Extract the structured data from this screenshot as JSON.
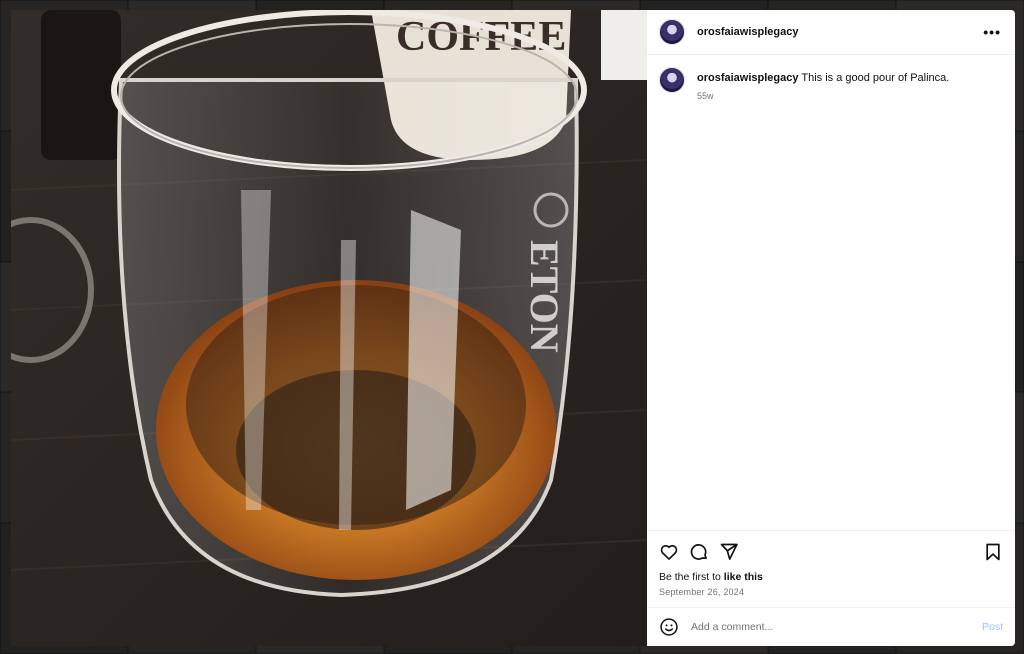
{
  "post": {
    "username": "orosfaiawisplegacy",
    "more_icon": "more-horizontal-icon",
    "caption": {
      "username": "orosfaiawisplegacy",
      "text": "This is a good pour of Palinca.",
      "time_ago": "55w"
    },
    "likes": {
      "prefix": "Be the first to ",
      "link": "like this"
    },
    "date": "September 26, 2024",
    "comment": {
      "placeholder": "Add a comment...",
      "post_label": "Post"
    },
    "glass_text": [
      "COFFEE",
      "ETON"
    ]
  },
  "colors": {
    "post_button": "#9ec3f0",
    "liquid": "#c4681a",
    "table": "#2a2522"
  }
}
